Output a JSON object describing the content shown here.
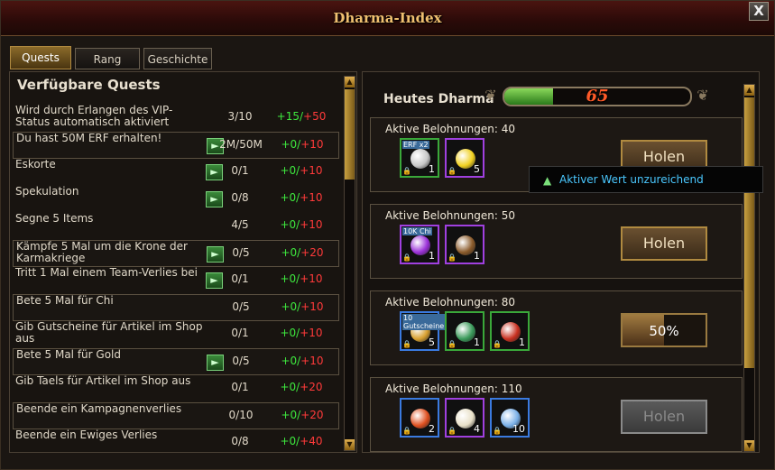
{
  "window": {
    "title": "Dharma-Index",
    "close_label": "X"
  },
  "tabs": [
    {
      "label": "Quests",
      "active": true
    },
    {
      "label": "Rang",
      "active": false
    },
    {
      "label": "Geschichte",
      "active": false
    }
  ],
  "quests": {
    "header": "Verfügbare Quests",
    "rows": [
      {
        "name": "Wird durch Erlangen des VIP-Status automatisch aktiviert",
        "progress": "3/10",
        "reward_plus": "+15/",
        "reward_max": "+50",
        "go": false,
        "boxed": false
      },
      {
        "name": "Du hast 50M ERF erhalten!",
        "progress": "2M/50M",
        "reward_plus": "+0/",
        "reward_max": "+10",
        "go": true,
        "boxed": true
      },
      {
        "name": "Eskorte",
        "progress": "0/1",
        "reward_plus": "+0/",
        "reward_max": "+10",
        "go": true,
        "boxed": false
      },
      {
        "name": "Spekulation",
        "progress": "0/8",
        "reward_plus": "+0/",
        "reward_max": "+10",
        "go": true,
        "boxed": false
      },
      {
        "name": "Segne 5 Items",
        "progress": "4/5",
        "reward_plus": "+0/",
        "reward_max": "+10",
        "go": false,
        "boxed": false
      },
      {
        "name": "Kämpfe 5 Mal um die Krone der Karmakriege",
        "progress": "0/5",
        "reward_plus": "+0/",
        "reward_max": "+20",
        "go": true,
        "boxed": true
      },
      {
        "name": "Tritt 1 Mal einem Team-Verlies bei",
        "progress": "0/1",
        "reward_plus": "+0/",
        "reward_max": "+10",
        "go": true,
        "boxed": false
      },
      {
        "name": "Bete 5 Mal für Chi",
        "progress": "0/5",
        "reward_plus": "+0/",
        "reward_max": "+10",
        "go": false,
        "boxed": true
      },
      {
        "name": "Gib Gutscheine für Artikel im Shop aus",
        "progress": "0/1",
        "reward_plus": "+0/",
        "reward_max": "+10",
        "go": false,
        "boxed": false
      },
      {
        "name": "Bete 5 Mal für Gold",
        "progress": "0/5",
        "reward_plus": "+0/",
        "reward_max": "+10",
        "go": true,
        "boxed": true
      },
      {
        "name": "Gib Taels für Artikel im Shop aus",
        "progress": "0/1",
        "reward_plus": "+0/",
        "reward_max": "+20",
        "go": false,
        "boxed": false
      },
      {
        "name": "Beende ein Kampagnenverlies",
        "progress": "0/10",
        "reward_plus": "+0/",
        "reward_max": "+20",
        "go": false,
        "boxed": true
      },
      {
        "name": "Beende ein Ewiges Verlies",
        "progress": "0/8",
        "reward_plus": "+0/",
        "reward_max": "+40",
        "go": false,
        "boxed": false
      }
    ]
  },
  "dharma": {
    "label": "Heutes Dharma",
    "value": "65",
    "fill_fraction": 0.26
  },
  "rewards": {
    "label": "Aktive Belohnungen:",
    "cards": [
      {
        "threshold": "40",
        "button": "Holen",
        "state": "button",
        "items": [
          {
            "badge": "ERF x2",
            "count": "1",
            "border": "#3aa83a",
            "icon": "silver-orb-icon",
            "color": "#c8c8c8"
          },
          {
            "badge": "",
            "count": "5",
            "border": "#a040e0",
            "icon": "yellow-gem-icon",
            "color": "#f0d020"
          }
        ]
      },
      {
        "threshold": "50",
        "button": "Holen",
        "state": "button",
        "items": [
          {
            "badge": "10K Chi",
            "count": "1",
            "border": "#a040e0",
            "icon": "purple-orb-icon",
            "color": "#9a30d8"
          },
          {
            "badge": "",
            "count": "1",
            "border": "#a040e0",
            "icon": "scroll-icon",
            "color": "#8a5a2a"
          }
        ]
      },
      {
        "threshold": "80",
        "button": "50%",
        "state": "progress",
        "progress_fraction": 0.5,
        "items": [
          {
            "badge": "10 Gutscheine",
            "count": "5",
            "border": "#3a7ae0",
            "icon": "voucher-icon",
            "color": "#d8a030"
          },
          {
            "badge": "",
            "count": "1",
            "border": "#3aa83a",
            "icon": "green-orb-icon",
            "color": "#3a9a5a"
          },
          {
            "badge": "",
            "count": "1",
            "border": "#3aa83a",
            "icon": "treasure-chest-icon",
            "color": "#c83020"
          }
        ]
      },
      {
        "threshold": "110",
        "button": "Holen",
        "state": "disabled",
        "items": [
          {
            "badge": "",
            "count": "2",
            "border": "#3a7ae0",
            "icon": "fire-orbs-icon",
            "color": "#e05020"
          },
          {
            "badge": "",
            "count": "4",
            "border": "#a040e0",
            "icon": "feather-icon",
            "color": "#e8e0c8"
          },
          {
            "badge": "",
            "count": "10",
            "border": "#3a7ae0",
            "icon": "crystal-icon",
            "color": "#7ab0e8"
          }
        ]
      }
    ]
  },
  "tooltip": {
    "text": "Aktiver Wert unzureichend",
    "icon": "arrow-up-icon"
  }
}
